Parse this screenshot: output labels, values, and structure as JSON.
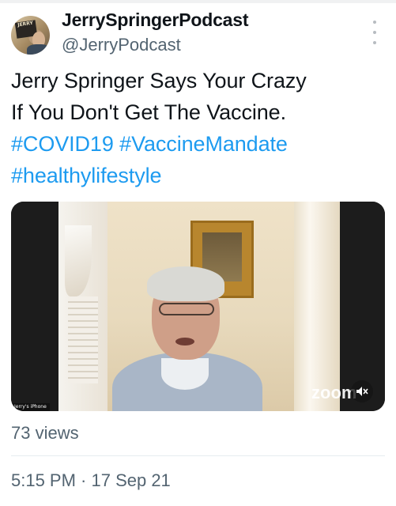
{
  "tweet": {
    "author": {
      "display_name": "JerrySpringerPodcast",
      "handle": "@JerryPodcast",
      "avatar_badge": "JERRY"
    },
    "text": {
      "line1": "Jerry Springer Says Your Crazy",
      "line2": "If You Don't Get The Vaccine.",
      "hashtags": [
        "#COVID19",
        "#VaccineMandate",
        "#healthylifestyle"
      ]
    },
    "video": {
      "watermark": "zoom",
      "source_label": "Jerry's iPhone",
      "mute_icon": "speaker-muted-icon"
    },
    "views": "73 views",
    "timestamp": "5:15 PM · 17 Sep 21",
    "more_icon": "more-vertical-icon"
  },
  "colors": {
    "text": "#0f1419",
    "secondary": "#536471",
    "link": "#1d9bf0",
    "divider": "#e6ecf0"
  }
}
